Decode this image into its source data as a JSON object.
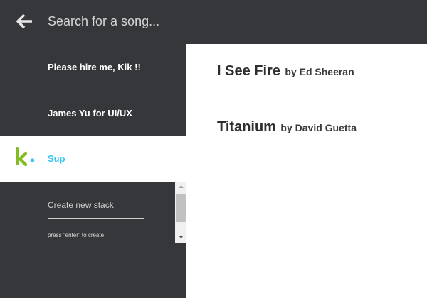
{
  "header": {
    "back_icon": "arrow-left-icon",
    "search_placeholder": "Search for a song..."
  },
  "sidebar": {
    "stacks": [
      {
        "label": "Please hire me, Kik !!"
      },
      {
        "label": "James Yu for UI/UX"
      },
      {
        "label": "Sup",
        "active": true,
        "logo": "kik-logo"
      }
    ],
    "create": {
      "placeholder": "Create new stack",
      "hint": "press \"enter\" to create"
    }
  },
  "content": {
    "songs": [
      {
        "title": "I See Fire",
        "artist_line": "by Ed Sheeran"
      },
      {
        "title": "Titanium",
        "artist_line": "by David Guetta"
      }
    ]
  },
  "colors": {
    "sidebar_bg": "#35373b",
    "accent": "#3cc7f0",
    "kik_green": "#82bc23",
    "content_bg": "#ffffff"
  }
}
